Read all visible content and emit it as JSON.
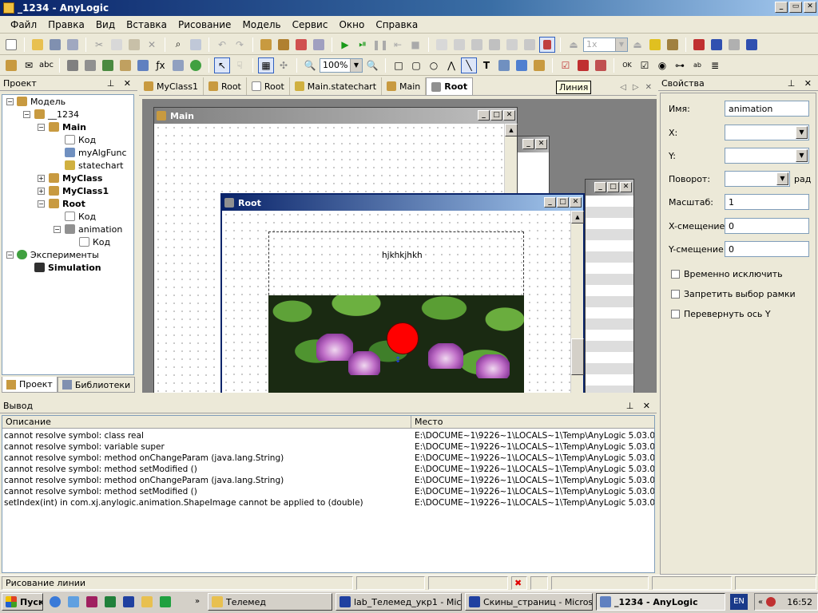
{
  "window": {
    "title": "_1234 - AnyLogic"
  },
  "menu": [
    "Файл",
    "Правка",
    "Вид",
    "Вставка",
    "Рисование",
    "Модель",
    "Сервис",
    "Окно",
    "Справка"
  ],
  "toolbar": {
    "speed": "1x",
    "zoom": "100%"
  },
  "tooltip": "Линия",
  "project_panel": {
    "title": "Проект",
    "tree": [
      {
        "label": "Модель",
        "bold": false
      },
      {
        "label": "__1234",
        "bold": false
      },
      {
        "label": "Main",
        "bold": true
      },
      {
        "label": "Код",
        "bold": false
      },
      {
        "label": "myAlgFunc",
        "bold": false
      },
      {
        "label": "statechart",
        "bold": false
      },
      {
        "label": "MyClass",
        "bold": true
      },
      {
        "label": "MyClass1",
        "bold": true
      },
      {
        "label": "Root",
        "bold": true
      },
      {
        "label": "Код",
        "bold": false
      },
      {
        "label": "animation",
        "bold": false
      },
      {
        "label": "Код",
        "bold": false
      },
      {
        "label": "Эксперименты",
        "bold": false
      },
      {
        "label": "Simulation",
        "bold": true
      }
    ],
    "tabs": [
      "Проект",
      "Библиотеки"
    ]
  },
  "editor": {
    "tabs": [
      "MyClass1",
      "Root",
      "Root",
      "Main.statechart",
      "Main",
      "Root"
    ],
    "windows": {
      "main_title": "Main",
      "root_title": "Root",
      "root_text": "hjkhkjhkh"
    }
  },
  "properties": {
    "title": "Свойства",
    "fields": {
      "name_label": "Имя:",
      "name_value": "animation",
      "x_label": "X:",
      "y_label": "Y:",
      "rotation_label": "Поворот:",
      "rotation_unit": "рад",
      "scale_label": "Масштаб:",
      "scale_value": "1",
      "xoffset_label": "X-смещение:",
      "xoffset_value": "0",
      "yoffset_label": "Y-смещение:",
      "yoffset_value": "0"
    },
    "checkboxes": [
      "Временно исключить",
      "Запретить выбор рамки",
      "Перевернуть ось Y"
    ]
  },
  "output": {
    "title": "Вывод",
    "columns": [
      "Описание",
      "Место"
    ],
    "rows": [
      {
        "desc": "cannot resolve symbol: class real",
        "place": "E:\\DOCUME~1\\9226~1\\LOCALS~1\\Temp\\AnyLogic 5.03.0..."
      },
      {
        "desc": "cannot resolve symbol: variable super",
        "place": "E:\\DOCUME~1\\9226~1\\LOCALS~1\\Temp\\AnyLogic 5.03.0..."
      },
      {
        "desc": "cannot resolve symbol: method onChangeParam (java.lang.String)",
        "place": "E:\\DOCUME~1\\9226~1\\LOCALS~1\\Temp\\AnyLogic 5.03.0..."
      },
      {
        "desc": "cannot resolve symbol: method setModified ()",
        "place": "E:\\DOCUME~1\\9226~1\\LOCALS~1\\Temp\\AnyLogic 5.03.0..."
      },
      {
        "desc": "cannot resolve symbol: method onChangeParam (java.lang.String)",
        "place": "E:\\DOCUME~1\\9226~1\\LOCALS~1\\Temp\\AnyLogic 5.03.0..."
      },
      {
        "desc": "cannot resolve symbol: method setModified ()",
        "place": "E:\\DOCUME~1\\9226~1\\LOCALS~1\\Temp\\AnyLogic 5.03.0..."
      },
      {
        "desc": "setIndex(int) in com.xj.anylogic.animation.ShapeImage cannot be applied to (double)",
        "place": "E:\\DOCUME~1\\9226~1\\LOCALS~1\\Temp\\AnyLogic 5.03.0..."
      }
    ]
  },
  "status": {
    "text": "Рисование линии"
  },
  "taskbar": {
    "start": "Пуск",
    "tasks": [
      "Телемед",
      "lab_Телемед_укр1 - Mic...",
      "Скины_страниц - Micros...",
      "_1234 - AnyLogic"
    ],
    "lang": "EN",
    "clock": "16:52"
  }
}
